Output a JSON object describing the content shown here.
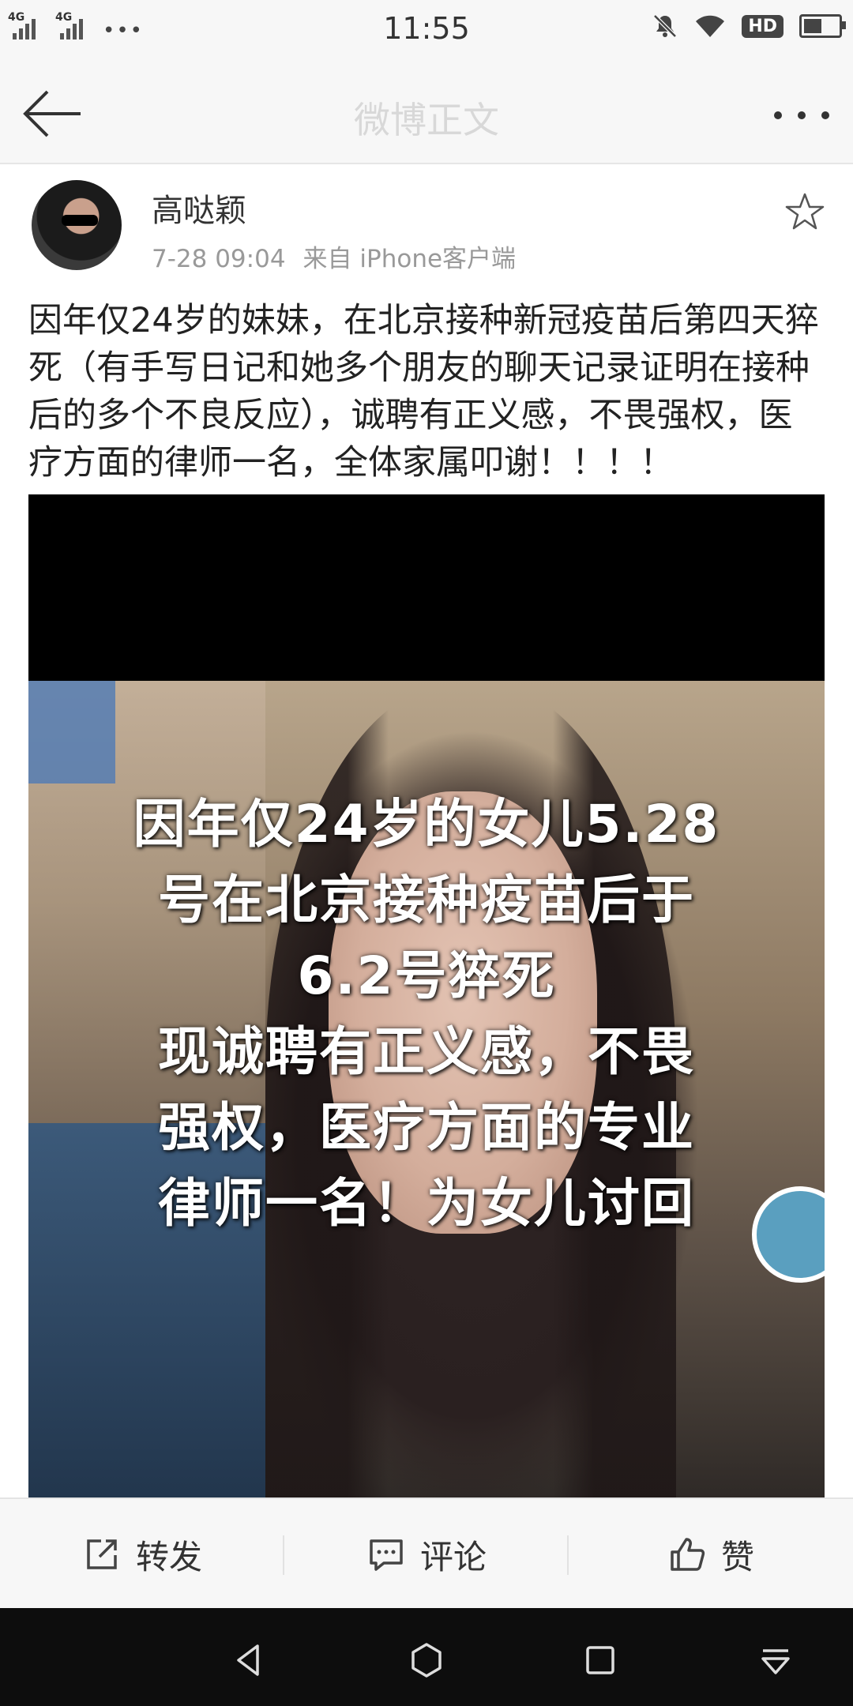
{
  "status_bar": {
    "net1": "4G",
    "net2": "4G",
    "dots": "•••",
    "time": "11:55",
    "hd": "HD",
    "battery_level": 0.6
  },
  "header": {
    "title": "微博正文",
    "back_icon": "arrow-left-icon",
    "more_icon": "more-horizontal-icon"
  },
  "post": {
    "author": "高哒颖",
    "time": "7-28 09:04",
    "source": "来自 iPhone客户端",
    "text": "因年仅24岁的妹妹，在北京接种新冠疫苗后第四天猝死（有手写日记和她多个朋友的聊天记录证明在接种后的多个不良反应），诚聘有正义感，不畏强权，医疗方面的律师一名，全体家属叩谢！！！！",
    "favorite_icon": "star-outline-icon",
    "image_caption_lines": [
      "因年仅24岁的女儿5.28",
      "号在北京接种疫苗后于",
      "6.2号猝死",
      "现诚聘有正义感，不畏",
      "强权，医疗方面的专业",
      "律师一名！为女儿讨回"
    ]
  },
  "actions": {
    "repost": "转发",
    "comment": "评论",
    "like": "赞"
  },
  "nav": {
    "back_icon": "nav-back-icon",
    "home_icon": "nav-home-icon",
    "recents_icon": "nav-recents-icon",
    "menu_icon": "nav-menu-icon"
  }
}
